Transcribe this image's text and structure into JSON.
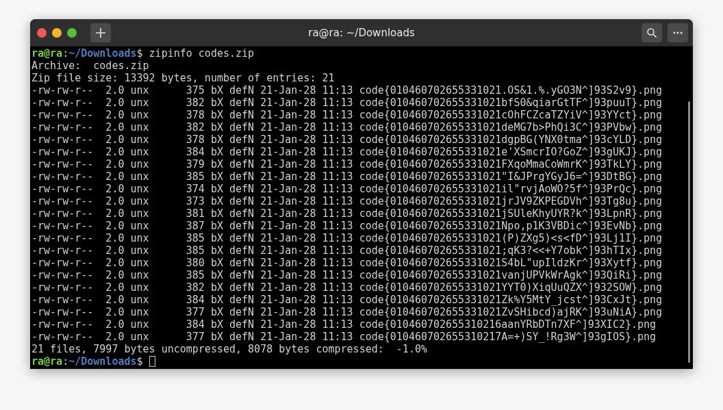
{
  "window": {
    "title": "ra@ra: ~/Downloads"
  },
  "terminal": {
    "lines": [
      {
        "kind": "prompt",
        "user": "ra@ra",
        "sep": ":",
        "path": "~/Downloads",
        "symbol": "$",
        "command": " zipinfo codes.zip"
      },
      {
        "kind": "output",
        "text": "Archive:  codes.zip"
      },
      {
        "kind": "output",
        "text": "Zip file size: 13392 bytes, number of entries: 21"
      },
      {
        "kind": "output",
        "text": "-rw-rw-r--  2.0 unx      375 bX defN 21-Jan-28 11:13 code{010460702655331021.OS&1.%.yGO3N^]93S2v9}.png"
      },
      {
        "kind": "output",
        "text": "-rw-rw-r--  2.0 unx      382 bX defN 21-Jan-28 11:13 code{010460702655331021bfS0&qiarGtTF^]93puuT}.png"
      },
      {
        "kind": "output",
        "text": "-rw-rw-r--  2.0 unx      378 bX defN 21-Jan-28 11:13 code{010460702655331021cOhFCZcaTZYiV^]93YYct}.png"
      },
      {
        "kind": "output",
        "text": "-rw-rw-r--  2.0 unx      382 bX defN 21-Jan-28 11:13 code{010460702655331021deMG7b>PhQi3C^]93PVbw}.png"
      },
      {
        "kind": "output",
        "text": "-rw-rw-r--  2.0 unx      378 bX defN 21-Jan-28 11:13 code{010460702655331021dgpBG(YNX0tma^]93cYLD}.png"
      },
      {
        "kind": "output",
        "text": "-rw-rw-r--  2.0 unx      384 bX defN 21-Jan-28 11:13 code{010460702655331021e'XSmcrIO?GoZ^]93gUKJ}.png"
      },
      {
        "kind": "output",
        "text": "-rw-rw-r--  2.0 unx      379 bX defN 21-Jan-28 11:13 code{010460702655331021FXqoMmaCoWmrK^]93TkLY}.png"
      },
      {
        "kind": "output",
        "text": "-rw-rw-r--  2.0 unx      385 bX defN 21-Jan-28 11:13 code{010460702655331021\"I&JPrgYGyJ6=^]93DtBG}.png"
      },
      {
        "kind": "output",
        "text": "-rw-rw-r--  2.0 unx      374 bX defN 21-Jan-28 11:13 code{010460702655331021il\"rvjAoWO?5f^]93PrQc}.png"
      },
      {
        "kind": "output",
        "text": "-rw-rw-r--  2.0 unx      373 bX defN 21-Jan-28 11:13 code{010460702655331021jrJV9ZKPEGDVh^]93Tg8u}.png"
      },
      {
        "kind": "output",
        "text": "-rw-rw-r--  2.0 unx      381 bX defN 21-Jan-28 11:13 code{010460702655331021jSUleKhyUYR?k^]93LpnR}.png"
      },
      {
        "kind": "output",
        "text": "-rw-rw-r--  2.0 unx      387 bX defN 21-Jan-28 11:13 code{010460702655331021Npo,p1K3VBDic^]93EvNb}.png"
      },
      {
        "kind": "output",
        "text": "-rw-rw-r--  2.0 unx      385 bX defN 21-Jan-28 11:13 code{010460702655331021(P)ZXg5)<s<fD^]93Lj1I}.png"
      },
      {
        "kind": "output",
        "text": "-rw-rw-r--  2.0 unx      385 bX defN 21-Jan-28 11:13 code{010460702655331021;qK3?<<+Y7obk^]93hTIx}.png"
      },
      {
        "kind": "output",
        "text": "-rw-rw-r--  2.0 unx      380 bX defN 21-Jan-28 11:13 code{010460702655331021S4bL\"upIldzKr^]93Xytf}.png"
      },
      {
        "kind": "output",
        "text": "-rw-rw-r--  2.0 unx      385 bX defN 21-Jan-28 11:13 code{010460702655331021vanjUPVkWrAgk^]93QiRi}.png"
      },
      {
        "kind": "output",
        "text": "-rw-rw-r--  2.0 unx      382 bX defN 21-Jan-28 11:13 code{010460702655331021YYT0)XiqUuQZX^]932SOW}.png"
      },
      {
        "kind": "output",
        "text": "-rw-rw-r--  2.0 unx      384 bX defN 21-Jan-28 11:13 code{010460702655331021Zk%Y5MtY_jcst^]93CxJt}.png"
      },
      {
        "kind": "output",
        "text": "-rw-rw-r--  2.0 unx      377 bX defN 21-Jan-28 11:13 code{010460702655331021ZvSHibcd)ajRK^]93uNiA}.png"
      },
      {
        "kind": "output",
        "text": "-rw-rw-r--  2.0 unx      384 bX defN 21-Jan-28 11:13 code{010460702655310216aanYRbDTn7XF^]93XIC2}.png"
      },
      {
        "kind": "output",
        "text": "-rw-rw-r--  2.0 unx      377 bX defN 21-Jan-28 11:13 code{010460702655310217A=+)SY_!Rg3W^]93gIOS}.png"
      },
      {
        "kind": "output",
        "text": "21 files, 7997 bytes uncompressed, 8078 bytes compressed:  -1.0%"
      },
      {
        "kind": "prompt",
        "user": "ra@ra",
        "sep": ":",
        "path": "~/Downloads",
        "symbol": "$",
        "cursor": true
      }
    ]
  }
}
